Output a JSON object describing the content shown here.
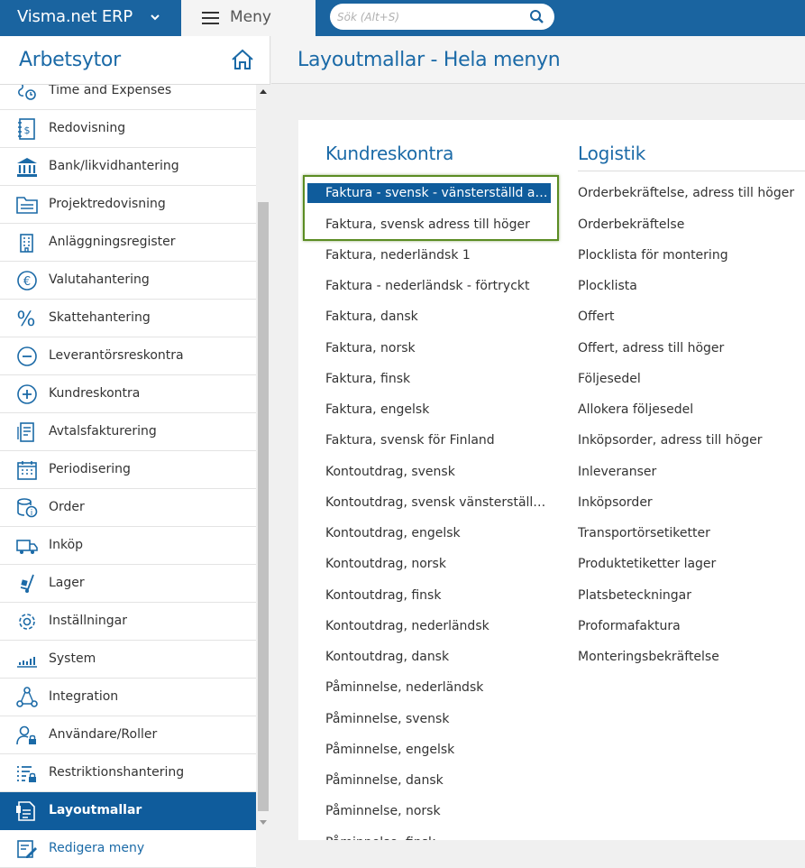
{
  "topbar": {
    "brand": "Visma.net ERP",
    "menu_label": "Meny",
    "search_placeholder": "Sök (Alt+S)"
  },
  "sidebar": {
    "title": "Arbetsytor",
    "items": [
      {
        "label": "Time and Expenses",
        "icon": "time-expenses-icon"
      },
      {
        "label": "Redovisning",
        "icon": "ledger-icon"
      },
      {
        "label": "Bank/likvidhantering",
        "icon": "bank-icon"
      },
      {
        "label": "Projektredovisning",
        "icon": "folder-icon"
      },
      {
        "label": "Anläggningsregister",
        "icon": "building-icon"
      },
      {
        "label": "Valutahantering",
        "icon": "euro-icon"
      },
      {
        "label": "Skattehantering",
        "icon": "percent-icon"
      },
      {
        "label": "Leverantörsreskontra",
        "icon": "minus-circle-icon"
      },
      {
        "label": "Kundreskontra",
        "icon": "plus-circle-icon"
      },
      {
        "label": "Avtalsfakturering",
        "icon": "contract-icon"
      },
      {
        "label": "Periodisering",
        "icon": "calendar-icon"
      },
      {
        "label": "Order",
        "icon": "database-info-icon"
      },
      {
        "label": "Inköp",
        "icon": "truck-icon"
      },
      {
        "label": "Lager",
        "icon": "hand-truck-icon"
      },
      {
        "label": "Inställningar",
        "icon": "gear-icon"
      },
      {
        "label": "System",
        "icon": "system-chart-icon"
      },
      {
        "label": "Integration",
        "icon": "integration-icon"
      },
      {
        "label": "Användare/Roller",
        "icon": "user-lock-icon"
      },
      {
        "label": "Restriktionshantering",
        "icon": "list-lock-icon"
      },
      {
        "label": "Layoutmallar",
        "icon": "layout-template-icon"
      },
      {
        "label": "Redigera meny",
        "icon": "edit-menu-icon"
      }
    ]
  },
  "main": {
    "title": "Layoutmallar - Hela menyn",
    "columns": [
      {
        "title": "Kundreskontra",
        "items": [
          "Faktura - svensk - vänsterställd adress",
          "Faktura, svensk adress till höger",
          "Faktura, nederländsk 1",
          "Faktura - nederländsk - förtryckt",
          "Faktura, dansk",
          "Faktura, norsk",
          "Faktura, finsk",
          "Faktura, engelsk",
          "Faktura, svensk för Finland",
          "Kontoutdrag, svensk",
          "Kontoutdrag, svensk vänsterställd adress",
          "Kontoutdrag, engelsk",
          "Kontoutdrag, norsk",
          "Kontoutdrag, finsk",
          "Kontoutdrag, nederländsk",
          "Kontoutdrag, dansk",
          "Påminnelse, nederländsk",
          "Påminnelse, svensk",
          "Påminnelse, engelsk",
          "Påminnelse, dansk",
          "Påminnelse, norsk",
          "Påminnelse, finsk"
        ]
      },
      {
        "title": "Logistik",
        "items": [
          "Orderbekräftelse, adress till höger",
          "Orderbekräftelse",
          "Plocklista för montering",
          "Plocklista",
          "Offert",
          "Offert, adress till höger",
          "Följesedel",
          "Allokera följesedel",
          "Inköpsorder, adress till höger",
          "Inleveranser",
          "Inköpsorder",
          "Transportörsetiketter",
          "Produktetiketter lager",
          "Platsbeteckningar",
          "Proformafaktura",
          "Monteringsbekräftelse"
        ]
      }
    ]
  },
  "colors": {
    "brand_blue": "#1a64a0",
    "active_blue": "#0f5c9c",
    "title_blue": "#1b6aa7",
    "focus_green": "#5b8c23"
  }
}
